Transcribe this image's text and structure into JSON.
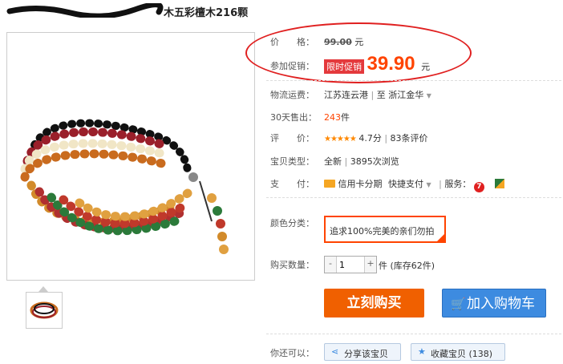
{
  "title": {
    "visible_text": "木五彩檀木216颗"
  },
  "price": {
    "label": "价　　格：",
    "original": "99.00",
    "unit": "元"
  },
  "promo": {
    "label": "参加促销：",
    "badge": "限时促销",
    "value": "39.90",
    "unit": "元"
  },
  "shipping": {
    "label": "物流运费：",
    "from": "江苏连云港",
    "sep": "至",
    "to": "浙江金华"
  },
  "sales": {
    "label": "30天售出：",
    "count": "243",
    "unit": "件"
  },
  "rating": {
    "label": "评　　价：",
    "stars": "★★★★★",
    "score": "4.7分",
    "reviews": "83条评价"
  },
  "type": {
    "label": "宝贝类型：",
    "condition": "全新",
    "views": "3895次浏览"
  },
  "payment": {
    "label": "支　　付：",
    "credit": "信用卡分期",
    "fast": "快捷支付",
    "services_label": "服务："
  },
  "color": {
    "label": "颜色分类：",
    "option": "追求100%完美的亲们勿拍"
  },
  "quantity": {
    "label": "购买数量：",
    "value": "1",
    "unit": "件",
    "stock": "(库存62件)"
  },
  "actions": {
    "buy": "立刻购买",
    "cart": "加入购物车"
  },
  "share_row": {
    "label": "你还可以：",
    "share": "分享该宝贝",
    "favorite": "收藏宝贝 (138)"
  },
  "colors": {
    "accent": "#ff4400",
    "buy": "#f06000",
    "cart": "#3d8be0",
    "promo_badge": "#e4393c",
    "oval": "#e02020"
  }
}
